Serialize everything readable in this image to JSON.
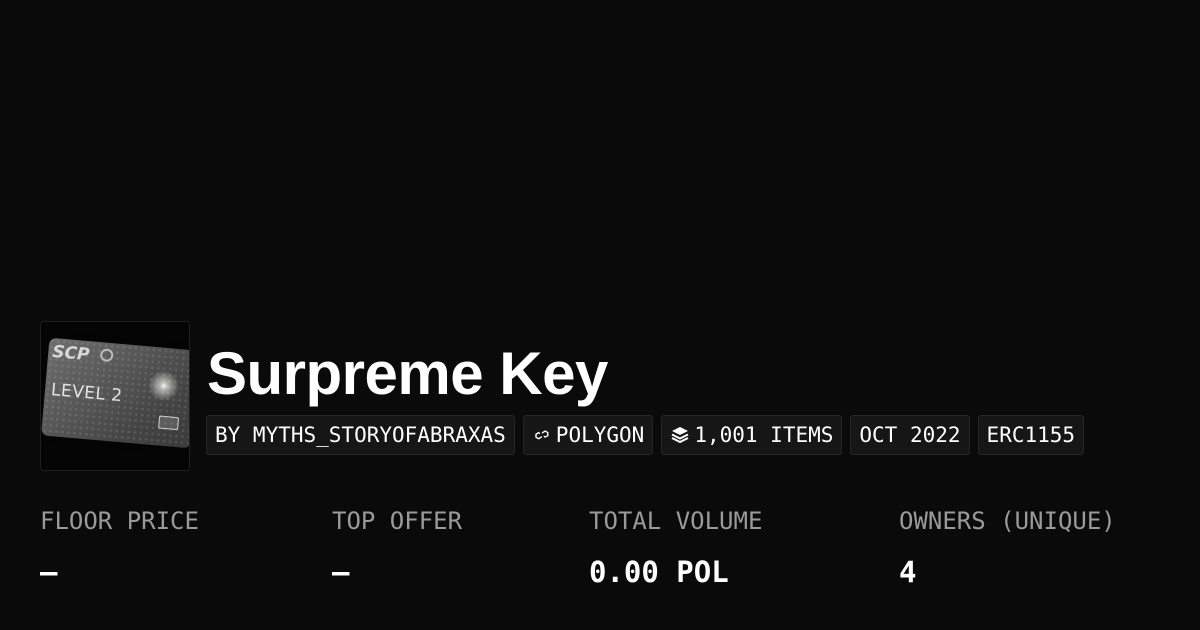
{
  "collection": {
    "name": "Surpreme Key",
    "image_alt": "SCP Level 2 key card",
    "image_text": {
      "brand": "SCP",
      "level": "LEVEL 2"
    }
  },
  "tags": {
    "creator": "BY MYTHS_STORYOFABRAXAS",
    "chain": "POLYGON",
    "chain_icon": "polygon-icon",
    "items": "1,001 ITEMS",
    "items_icon": "layers-icon",
    "date": "OCT 2022",
    "standard": "ERC1155"
  },
  "stats": [
    {
      "label": "FLOOR PRICE",
      "value": "–"
    },
    {
      "label": "TOP OFFER",
      "value": "–"
    },
    {
      "label": "TOTAL VOLUME",
      "value": "0.00 POL"
    },
    {
      "label": "OWNERS (UNIQUE)",
      "value": "4"
    }
  ],
  "colors": {
    "background": "#0a0a0a",
    "tag_background": "#161616",
    "label": "#9a9a9a",
    "text": "#ffffff"
  }
}
